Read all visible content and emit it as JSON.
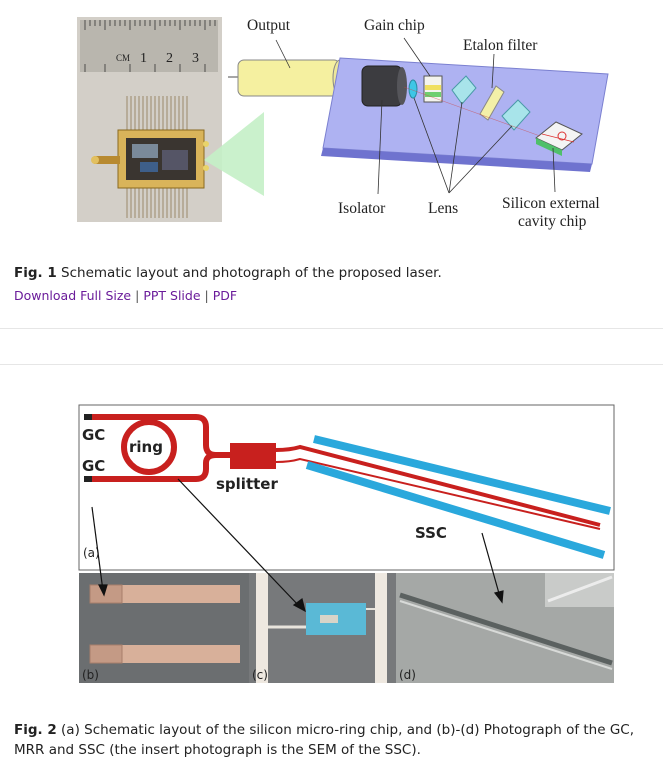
{
  "figure1": {
    "labels": {
      "output": "Output",
      "gain_chip": "Gain chip",
      "etalon_filter": "Etalon filter",
      "isolator": "Isolator",
      "lens": "Lens",
      "silicon_line1": "Silicon external",
      "silicon_line2": "cavity chip"
    },
    "ruler_label": "CM",
    "ruler_numbers": [
      "1",
      "2",
      "3"
    ],
    "caption_label": "Fig. 1",
    "caption_text": " Schematic layout and photograph of the proposed laser."
  },
  "links": {
    "full_size": "Download Full Size",
    "ppt": "PPT Slide",
    "pdf": "PDF",
    "separator": "|"
  },
  "figure2": {
    "labels": {
      "gc_top": "GC",
      "gc_bottom": "GC",
      "ring": "ring",
      "splitter": "splitter",
      "ssc": "SSC",
      "panel_a": "(a)",
      "panel_b": "(b)",
      "panel_c": "(c)",
      "panel_d": "(d)"
    },
    "caption_label": "Fig. 2",
    "caption_text": " (a) Schematic layout of the silicon micro-ring chip, and (b)-(d) Photograph of the GC, MRR and SSC (the insert photograph is the SEM of the SSC)."
  },
  "colors": {
    "waveguide_red": "#c8201e",
    "ssc_blue": "#2aa8dc",
    "board_purple": "#aeb2f2",
    "link_purple": "#6a1b9a"
  }
}
